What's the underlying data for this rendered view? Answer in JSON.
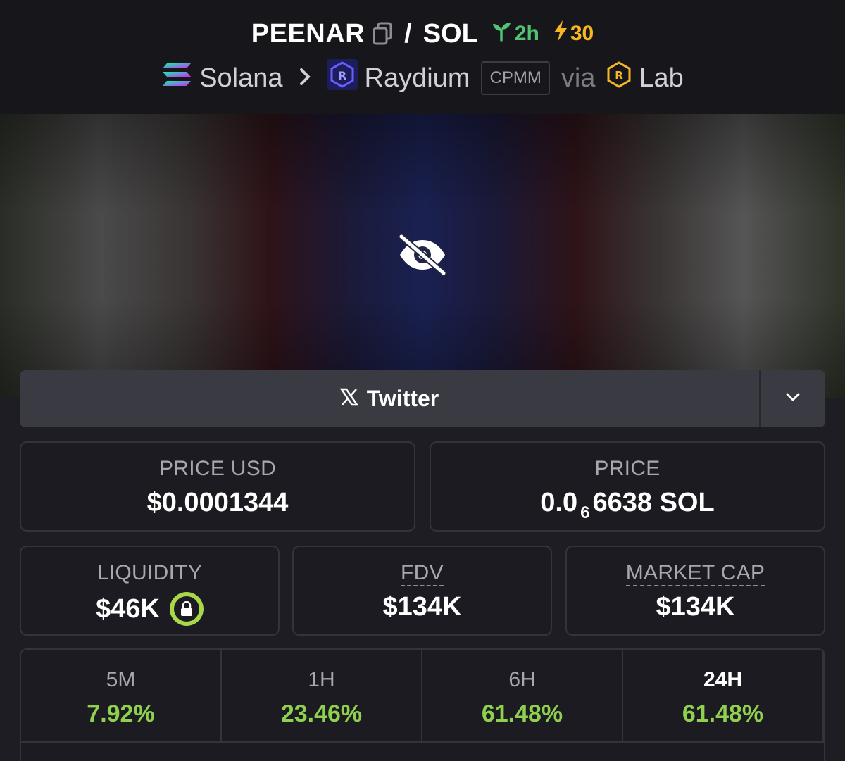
{
  "header": {
    "token_symbol": "PEENAR",
    "separator": "/",
    "quote_symbol": "SOL",
    "age": "2h",
    "boosts": "30",
    "chain": "Solana",
    "dex": "Raydium",
    "pool_type": "CPMM",
    "via_label": "via",
    "launchpad": "Lab"
  },
  "social": {
    "twitter_label": "Twitter"
  },
  "stats": {
    "price_usd_label": "PRICE USD",
    "price_usd_value": "$0.0001344",
    "price_label": "PRICE",
    "price_prefix": "0.0",
    "price_zero_count": "6",
    "price_suffix": "6638 SOL",
    "liquidity_label": "LIQUIDITY",
    "liquidity_value": "$46K",
    "fdv_label": "FDV",
    "fdv_value": "$134K",
    "mcap_label": "MARKET CAP",
    "mcap_value": "$134K"
  },
  "changes": [
    {
      "label": "5M",
      "value": "7.92%"
    },
    {
      "label": "1H",
      "value": "23.46%"
    },
    {
      "label": "6H",
      "value": "61.48%"
    },
    {
      "label": "24H",
      "value": "61.48%"
    }
  ],
  "colors": {
    "positive": "#8fd14f",
    "age": "#52c471",
    "boost": "#f6b626",
    "lock": "#a7d84a"
  }
}
